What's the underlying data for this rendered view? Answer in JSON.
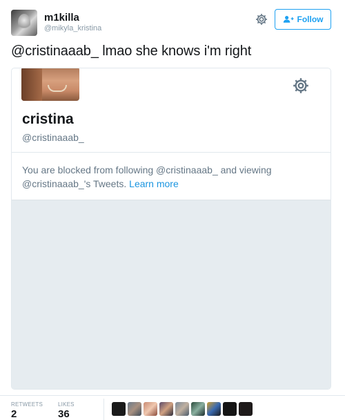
{
  "header": {
    "display_name": "m1killa",
    "handle": "@mikyla_kristina",
    "follow_label": "Follow"
  },
  "tweet": {
    "text": "@cristinaaab_ lmao she knows i'm right"
  },
  "card": {
    "name": "cristina",
    "handle": "@cristinaaab_",
    "blocked_text": "You are blocked from following @cristinaaab_ and viewing @cristinaaab_'s Tweets.",
    "learn_more": "Learn more"
  },
  "stats": {
    "retweets_label": "RETWEETS",
    "retweets_count": "2",
    "likes_label": "LIKES",
    "likes_count": "36"
  },
  "colors": {
    "accent": "#1da1f2",
    "link": "#1b95e0",
    "muted": "#657786",
    "panel": "#e6ecf0"
  }
}
